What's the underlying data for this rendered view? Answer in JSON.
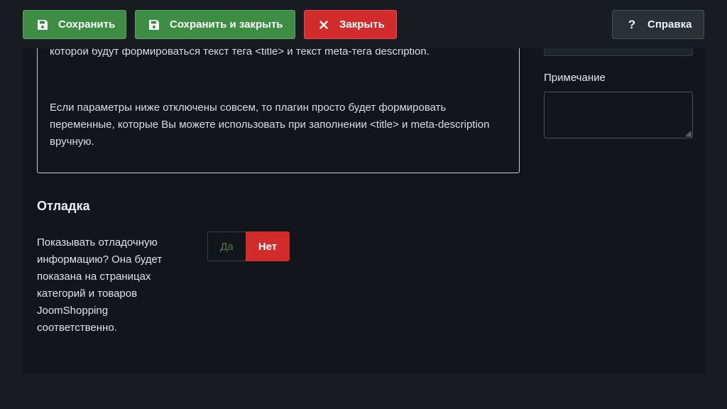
{
  "toolbar": {
    "save_label": "Сохранить",
    "save_close_label": "Сохранить и закрыть",
    "close_label": "Закрыть",
    "help_label": "Справка",
    "colors": {
      "success": "#3e8d45",
      "danger": "#d12b2b",
      "neutral": "#2b2f36"
    }
  },
  "info": {
    "paragraph1": "Параметры ниже позволяют задать единую для всех категорий и/или товаров формулу, по которой будут формироваться текст тега <title> и текст meta-тега description.",
    "paragraph2": "Если параметры ниже отключены совсем, то плагин просто будет формировать переменные, которые Вы можете использовать при заполнении <title> и meta-description вручную."
  },
  "debug": {
    "title": "Отладка",
    "field_label": "Показывать отладочную информацию? Она будет показана на страницах категорий и товаров JoomShopping соответственно.",
    "toggle": {
      "yes_label": "Да",
      "no_label": "Нет",
      "selected": "Нет"
    }
  },
  "sidebar": {
    "note_label": "Примечание",
    "note_value": ""
  }
}
